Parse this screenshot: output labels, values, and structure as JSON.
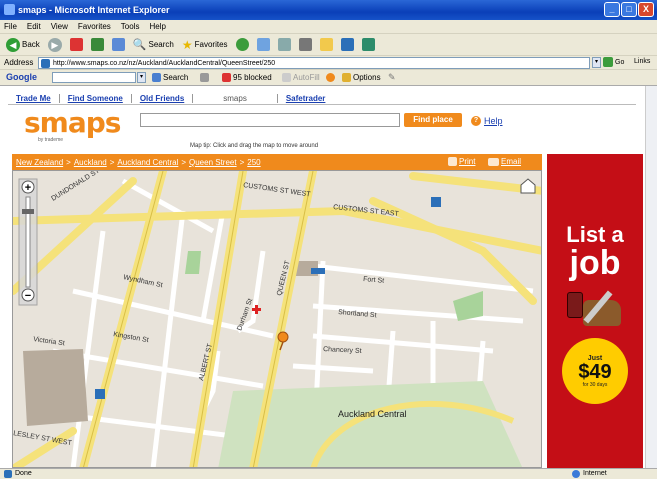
{
  "window": {
    "title": "smaps - Microsoft Internet Explorer",
    "min": "_",
    "max": "□",
    "close": "X"
  },
  "menu": [
    "File",
    "Edit",
    "View",
    "Favorites",
    "Tools",
    "Help"
  ],
  "toolbar": {
    "back": "Back",
    "search": "Search",
    "favorites": "Favorites"
  },
  "address": {
    "label": "Address",
    "url": "http://www.smaps.co.nz/nz/Auckland/AucklandCentral/QueenStreet/250",
    "go": "Go",
    "links": "Links"
  },
  "googlebar": {
    "label": "Google",
    "search": "Search",
    "blocked": "95 blocked",
    "autofill": "AutoFill",
    "options": "Options"
  },
  "nav": {
    "tabs": [
      "Trade Me",
      "Find Someone",
      "Old Friends",
      "smaps",
      "Safetrader"
    ]
  },
  "brand": {
    "logo": "smaps",
    "sub": "by trademe"
  },
  "search": {
    "value": "",
    "find": "Find place",
    "help": "Help"
  },
  "map_tip": "Map tip: Click and drag the map to move around",
  "breadcrumb": [
    "New Zealand",
    "Auckland",
    "Auckland Central",
    "Queen Street",
    "250"
  ],
  "breadcrumb_sep": ">",
  "crumb_actions": {
    "print": "Print",
    "email": "Email"
  },
  "map": {
    "labels": {
      "dundonald": "DUNDONALD ST",
      "customs_west": "CUSTOMS ST WEST",
      "customs_east": "CUSTOMS ST EAST",
      "albert": "ALBERT ST",
      "queen": "QUEEN ST",
      "kingston": "Kingston St",
      "wyndham": "Wyndham St",
      "chancery": "Chancery St",
      "victoria": "Victoria St",
      "lesley_west": "LESLEY ST WEST",
      "auckland_central": "Auckland Central",
      "fort": "Fort St",
      "shortland": "Shortland St",
      "durham": "Durham St"
    },
    "zoom_plus": "+",
    "zoom_minus": "−"
  },
  "ad": {
    "line1": "List a",
    "line2": "job",
    "just": "Just",
    "price": "$49",
    "period": "for 30 days"
  },
  "status": {
    "text": "Done",
    "zone": "Internet"
  },
  "colors": {
    "accent": "#f08a1c",
    "ad_red": "#c40e16",
    "link": "#1a3fb0"
  }
}
